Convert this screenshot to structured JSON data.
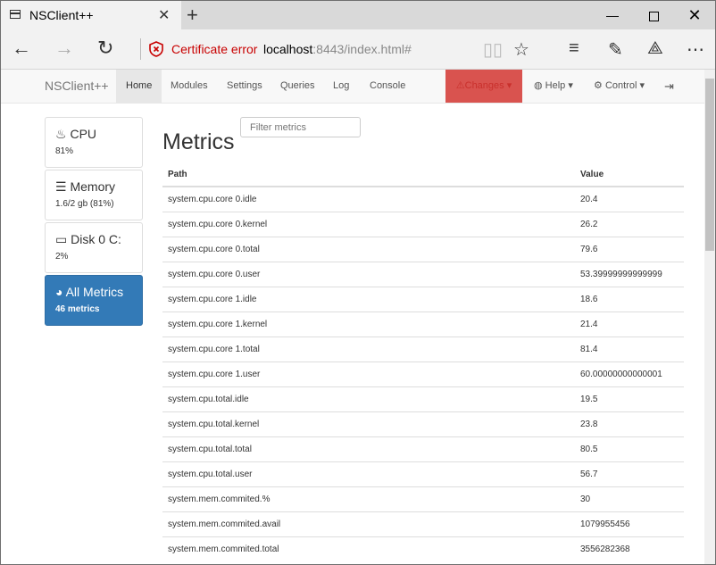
{
  "browser": {
    "tab_title": "NSClient++",
    "cert_error": "Certificate error",
    "url_host": "localhost",
    "url_rest": ":8443/index.html#"
  },
  "appnav": {
    "brand": "NSClient++",
    "items": [
      "Home",
      "Modules",
      "Settings",
      "Queries",
      "Log",
      "Console"
    ],
    "changes": "Changes",
    "help": "Help",
    "control": "Control"
  },
  "sidebar": [
    {
      "title": "CPU",
      "sub": "81%",
      "icon": "fire-icon"
    },
    {
      "title": "Memory",
      "sub": "1.6/2 gb (81%)",
      "icon": "server-icon"
    },
    {
      "title": "Disk 0 C:",
      "sub": "2%",
      "icon": "hdd-icon"
    },
    {
      "title": "All Metrics",
      "sub": "46 metrics",
      "icon": "dashboard-icon"
    }
  ],
  "main": {
    "filter_placeholder": "Filter metrics",
    "heading": "Metrics",
    "columns": [
      "Path",
      "Value"
    ],
    "rows": [
      [
        "system.cpu.core 0.idle",
        "20.4"
      ],
      [
        "system.cpu.core 0.kernel",
        "26.2"
      ],
      [
        "system.cpu.core 0.total",
        "79.6"
      ],
      [
        "system.cpu.core 0.user",
        "53.39999999999999"
      ],
      [
        "system.cpu.core 1.idle",
        "18.6"
      ],
      [
        "system.cpu.core 1.kernel",
        "21.4"
      ],
      [
        "system.cpu.core 1.total",
        "81.4"
      ],
      [
        "system.cpu.core 1.user",
        "60.00000000000001"
      ],
      [
        "system.cpu.total.idle",
        "19.5"
      ],
      [
        "system.cpu.total.kernel",
        "23.8"
      ],
      [
        "system.cpu.total.total",
        "80.5"
      ],
      [
        "system.cpu.total.user",
        "56.7"
      ],
      [
        "system.mem.commited.%",
        "30"
      ],
      [
        "system.mem.commited.avail",
        "1079955456"
      ],
      [
        "system.mem.commited.total",
        "3556282368"
      ]
    ]
  },
  "colors": {
    "active": "#337ab7",
    "danger": "#d9534f",
    "cert": "#c80000"
  }
}
